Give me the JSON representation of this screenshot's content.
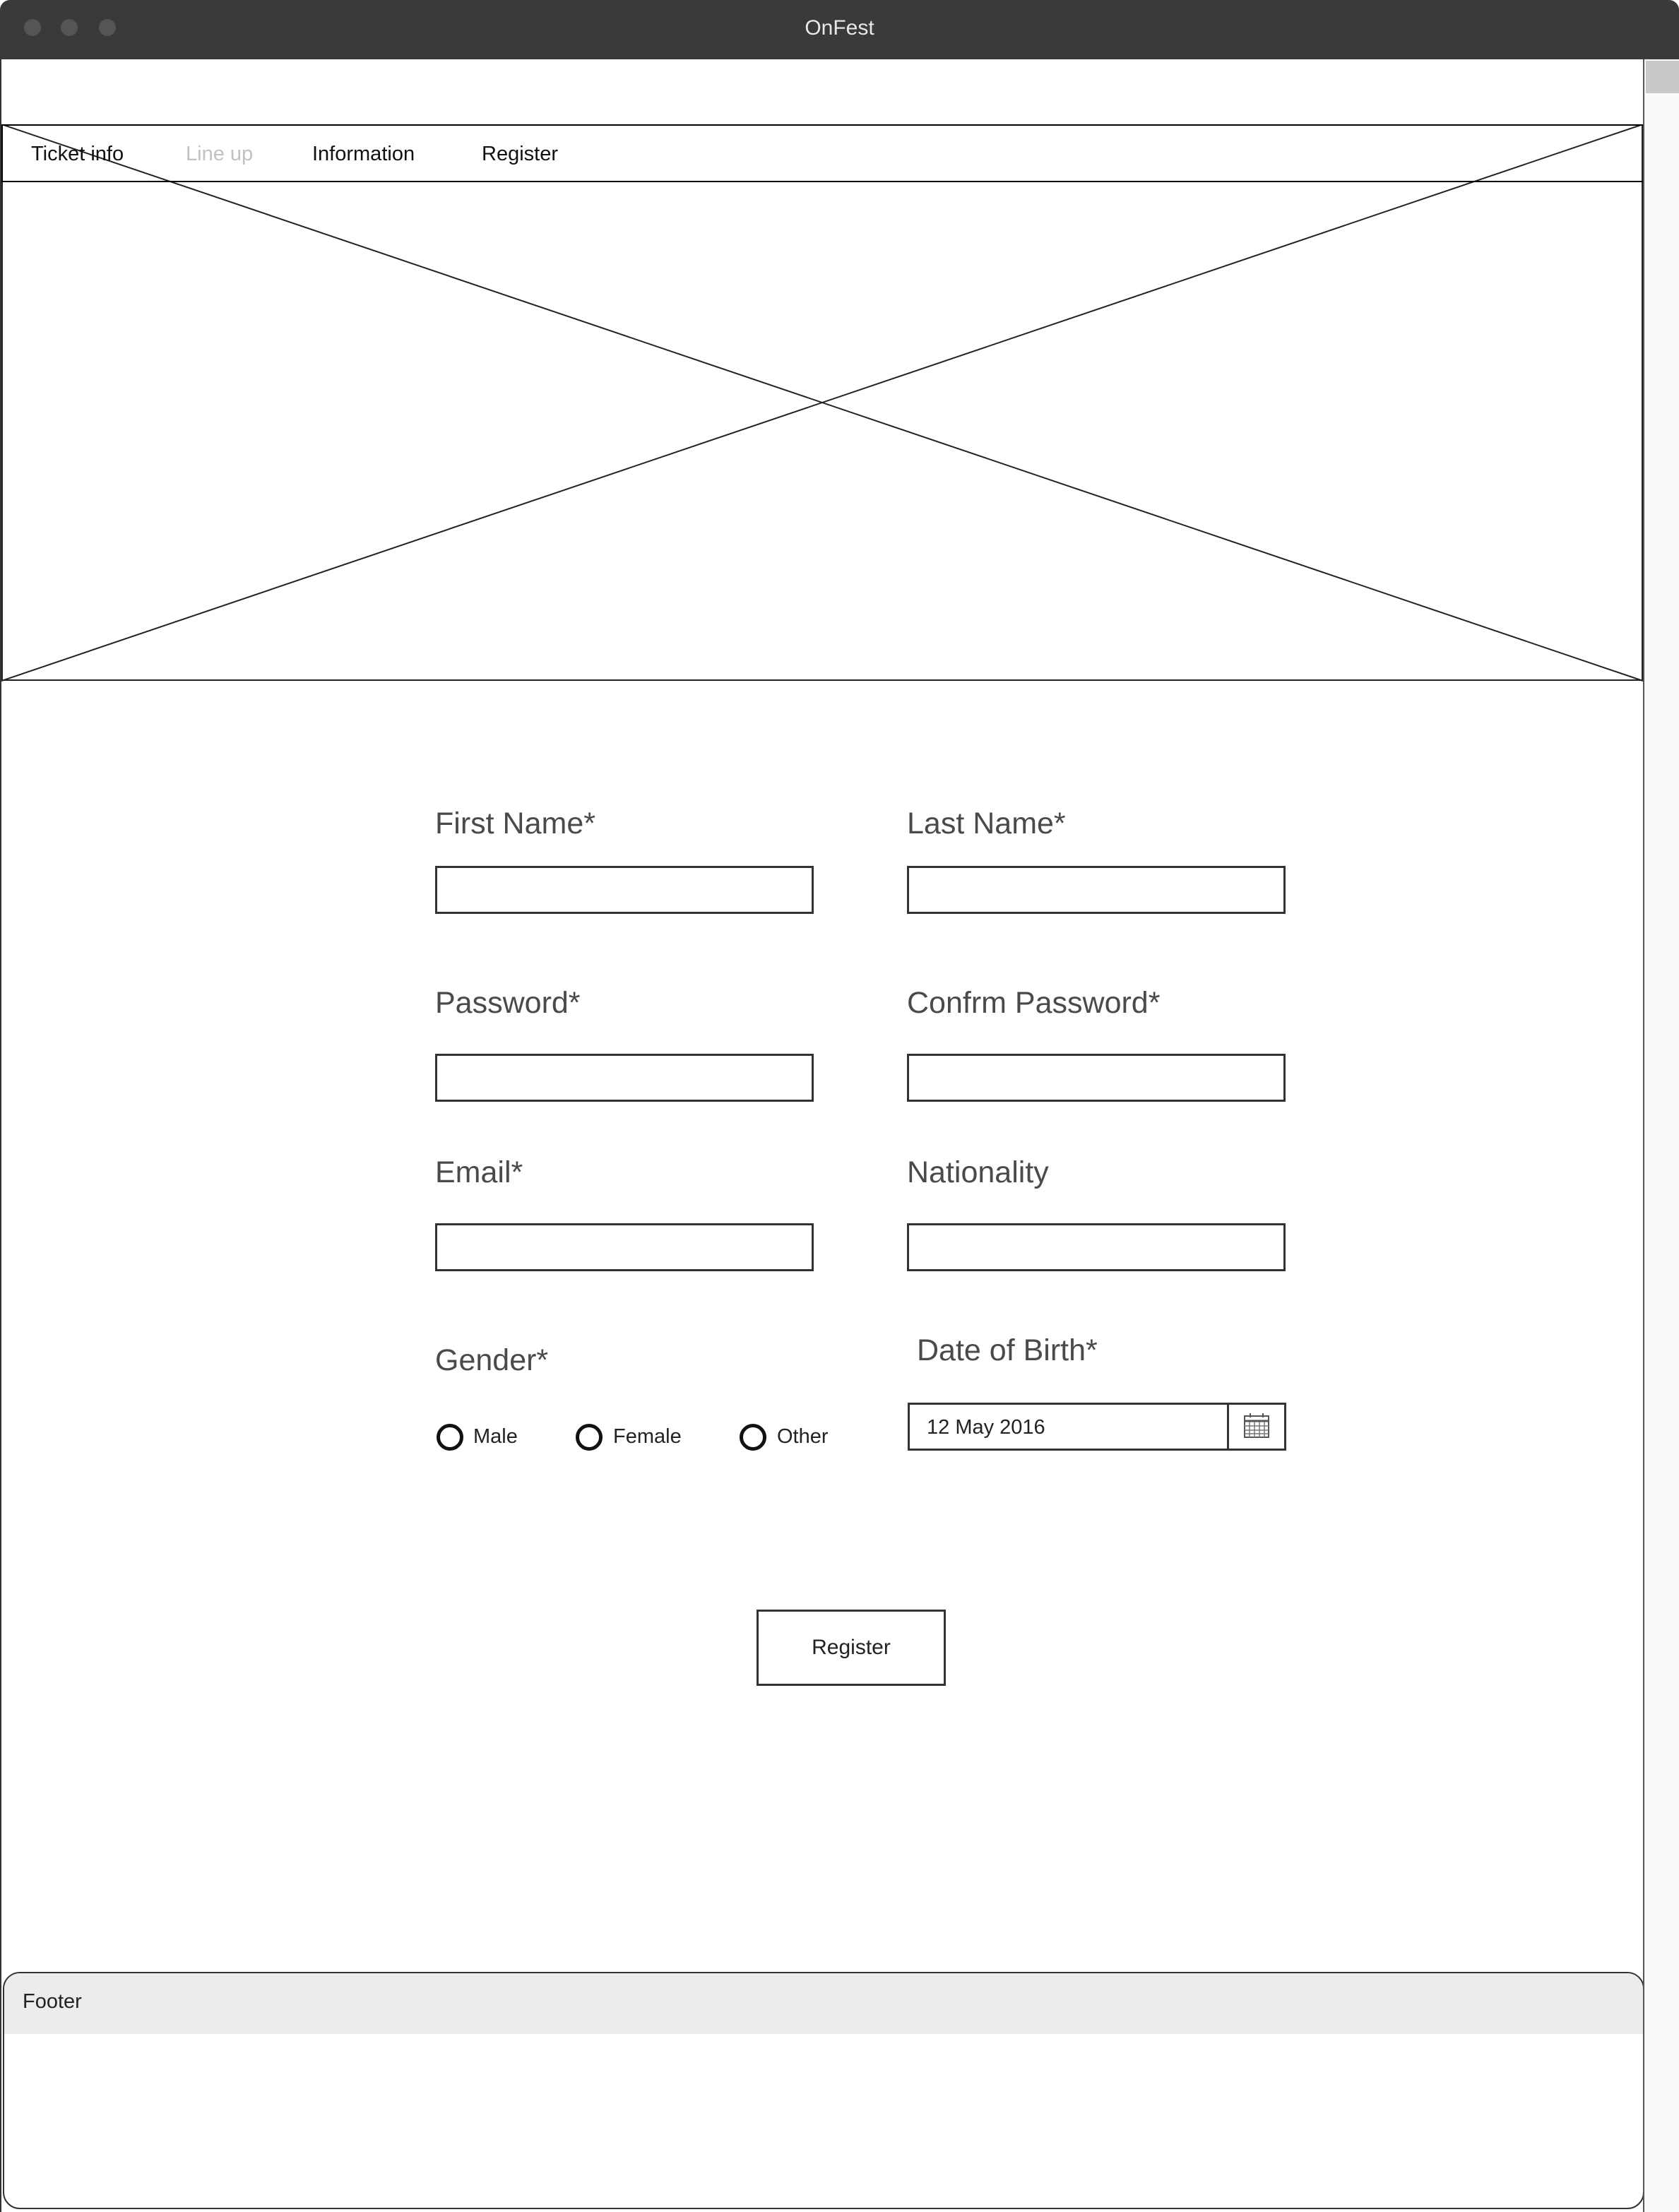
{
  "window": {
    "title": "OnFest"
  },
  "nav": {
    "items": [
      {
        "label": "Ticket info",
        "enabled": true
      },
      {
        "label": "Line up",
        "enabled": false
      },
      {
        "label": "Information",
        "enabled": true
      },
      {
        "label": "Register",
        "enabled": true
      }
    ]
  },
  "form": {
    "first_name": {
      "label": "First Name*",
      "value": ""
    },
    "last_name": {
      "label": "Last Name*",
      "value": ""
    },
    "password": {
      "label": "Password*",
      "value": ""
    },
    "confirm_password": {
      "label": "Confrm Password*",
      "value": ""
    },
    "email": {
      "label": "Email*",
      "value": ""
    },
    "nationality": {
      "label": "Nationality",
      "value": ""
    },
    "gender": {
      "label": "Gender*",
      "options": [
        "Male",
        "Female",
        "Other"
      ]
    },
    "dob": {
      "label": "Date of Birth*",
      "value": "12 May 2016",
      "icon": "calendar-icon"
    },
    "submit_label": "Register"
  },
  "footer": {
    "title": "Footer"
  }
}
